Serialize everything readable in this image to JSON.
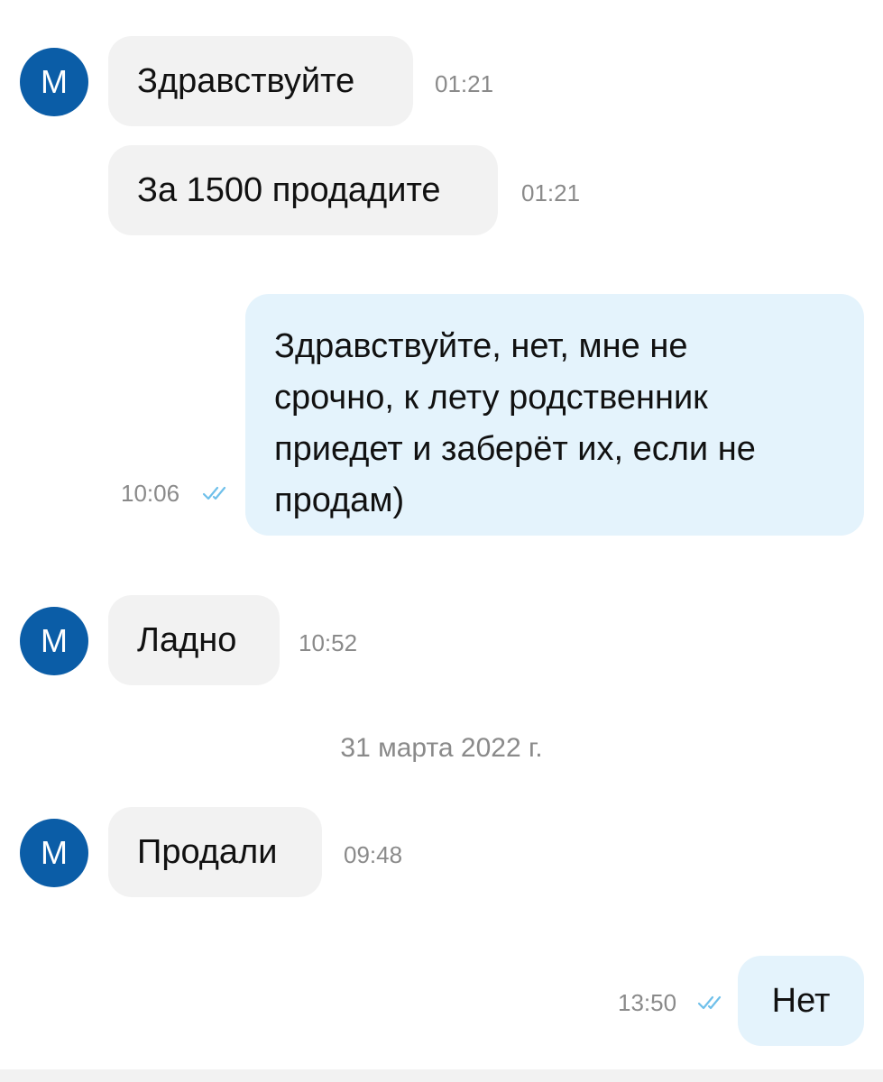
{
  "messages": [
    {
      "avatar": "М",
      "text": "Здравствуйте",
      "time": "01:21"
    },
    {
      "text": "За 1500 продадите",
      "time": "01:21"
    },
    {
      "outgoing": true,
      "lines": [
        "Здравствуйте, нет, мне не",
        "срочно, к лету родственник",
        "приедет и заберёт их, если не",
        "продам)"
      ],
      "time": "10:06",
      "status_icon": "double-check-icon"
    },
    {
      "avatar": "М",
      "text": "Ладно",
      "time": "10:52"
    },
    {
      "avatar": "М",
      "text": "Продали",
      "time": "09:48"
    },
    {
      "outgoing": true,
      "text": "Нет",
      "time": "13:50",
      "status_icon": "double-check-icon"
    }
  ],
  "date_separator": "31 марта 2022 г.",
  "colors": {
    "avatar_bg": "#0b5da7",
    "incoming_bubble": "#f2f2f2",
    "outgoing_bubble": "#e4f3fc",
    "read_check": "#6fc0ea",
    "timestamp": "#8a8a8a"
  }
}
